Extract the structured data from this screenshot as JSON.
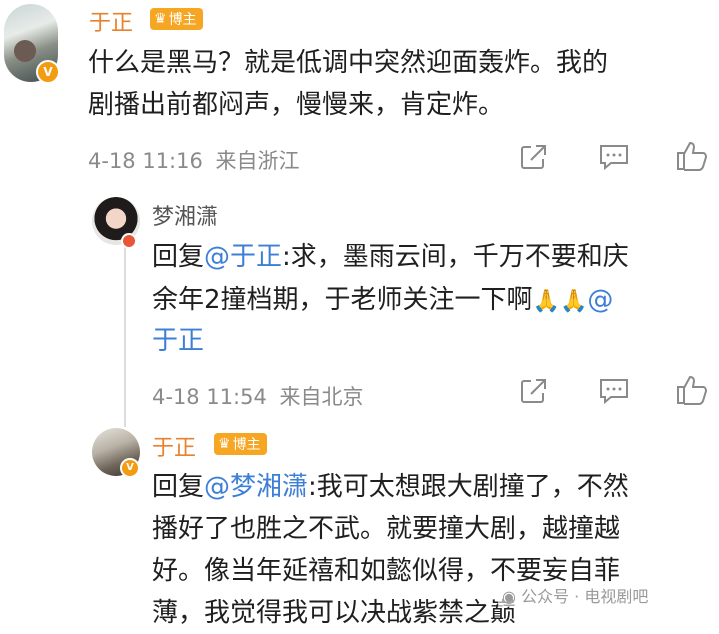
{
  "colors": {
    "name_orange": "#e8812b",
    "mention_blue": "#3d7fd6",
    "badge": "#f6a623",
    "meta_gray": "#8a8a8a"
  },
  "main_comment": {
    "author": "于正",
    "badge": "博主",
    "line1": "什么是黑马？就是低调中突然迎面轰炸。我的",
    "line2": "剧播出前都闷声，慢慢来，肯定炸。",
    "time": "4-18 11:16",
    "source": "来自浙江",
    "icons": [
      "share-icon",
      "comment-icon",
      "like-icon"
    ]
  },
  "reply1": {
    "author": "梦湘潇",
    "reply_prefix": "回复",
    "mention": "@于正",
    "line1_rest": ":求，墨雨云间，千万不要和庆",
    "line2_text": "余年2撞档期，于老师关注一下啊",
    "line2_emoji": "🙏🙏",
    "line2_mention": "@",
    "line3": "于正",
    "time": "4-18 11:54",
    "source": "来自北京"
  },
  "reply2": {
    "author": "于正",
    "badge": "博主",
    "reply_prefix": "回复",
    "mention": "@梦湘潇",
    "line1_rest": ":我可太想跟大剧撞了，不然",
    "line2": "播好了也胜之不武。就要撞大剧，越撞越",
    "line3": "好。像当年延禧和如懿似得，不要妄自菲",
    "line4": "薄，我觉得我可以决战紫禁之巅"
  },
  "watermark": {
    "text": "公众号 · 电视剧吧"
  }
}
